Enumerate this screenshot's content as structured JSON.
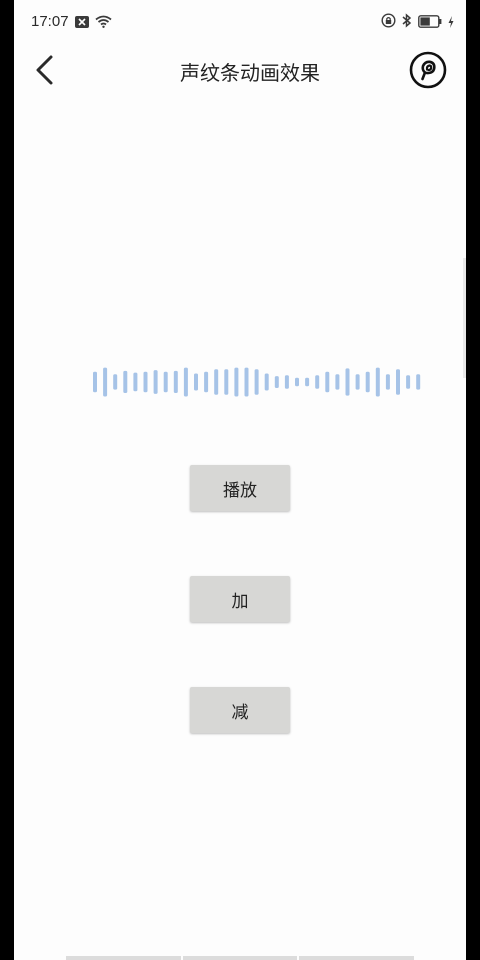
{
  "status_bar": {
    "time": "17:07",
    "left_icons": [
      "notification-x-icon",
      "wifi-icon"
    ],
    "right_icons": [
      "lock-rotation-icon",
      "bluetooth-icon",
      "battery-icon",
      "charging-icon"
    ],
    "battery_level": 0.55
  },
  "app_bar": {
    "title": "声纹条动画效果",
    "back_icon": "chevron-left-icon",
    "logo_icon": "app-logo-icon"
  },
  "waveform": {
    "color": "#a6c3e7",
    "bar_levels": [
      0.6,
      0.85,
      0.45,
      0.65,
      0.55,
      0.6,
      0.7,
      0.6,
      0.65,
      0.85,
      0.5,
      0.6,
      0.75,
      0.75,
      0.85,
      0.85,
      0.75,
      0.5,
      0.35,
      0.4,
      0.25,
      0.25,
      0.4,
      0.6,
      0.45,
      0.8,
      0.45,
      0.6,
      0.85,
      0.45,
      0.75,
      0.4,
      0.45
    ]
  },
  "buttons": {
    "play": "播放",
    "add": "加",
    "subtract": "减"
  },
  "colors": {
    "background": "#fdfdfd",
    "button": "#d7d7d5",
    "text": "#222222"
  }
}
